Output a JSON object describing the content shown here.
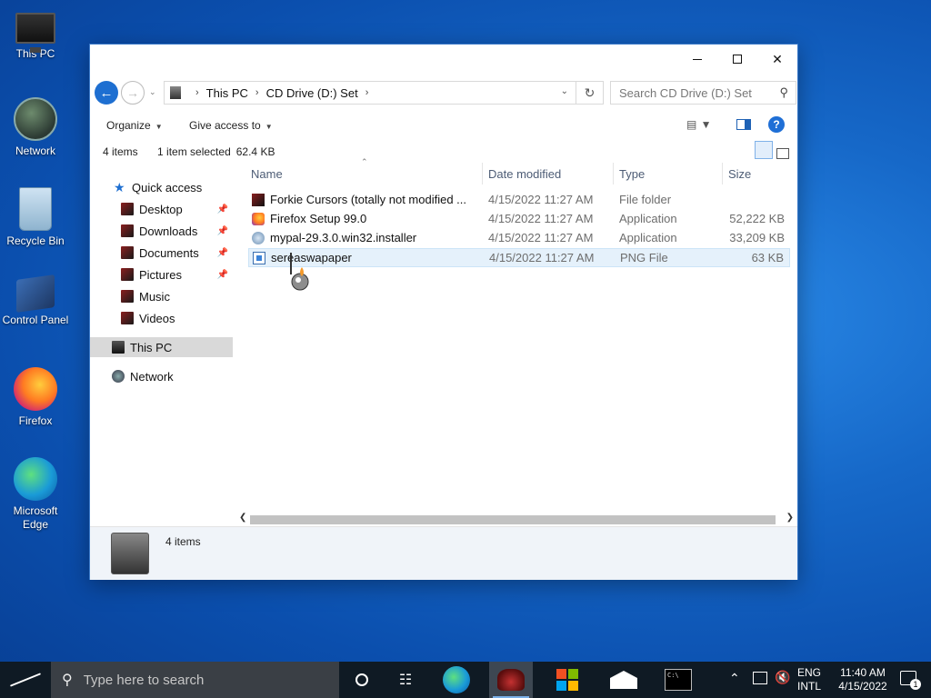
{
  "desktop": {
    "icons": [
      {
        "label": "This PC",
        "icon": "this-pc-icon"
      },
      {
        "label": "Network",
        "icon": "network-icon"
      },
      {
        "label": "Recycle Bin",
        "icon": "recycle-bin-icon"
      },
      {
        "label": "Control Panel",
        "icon": "control-panel-icon"
      },
      {
        "label": "Firefox",
        "icon": "firefox-icon"
      },
      {
        "label": "Microsoft Edge",
        "icon": "edge-icon"
      }
    ]
  },
  "window": {
    "controls": {
      "minimize": "minimize",
      "maximize": "maximize",
      "close": "✕"
    },
    "address": {
      "crumbs": [
        "This PC",
        "CD Drive (D:) Set"
      ],
      "separator": "›"
    },
    "search": {
      "placeholder": "Search CD Drive (D:) Set"
    },
    "commands": {
      "organize": "Organize",
      "give_access": "Give access to"
    },
    "status": {
      "count": "4 items",
      "selected": "1 item selected",
      "size": "62.4 KB"
    },
    "nav": {
      "quick_access": "Quick access",
      "items": [
        {
          "label": "Desktop",
          "pinned": true
        },
        {
          "label": "Downloads",
          "pinned": true
        },
        {
          "label": "Documents",
          "pinned": true
        },
        {
          "label": "Pictures",
          "pinned": true
        },
        {
          "label": "Music",
          "pinned": false
        },
        {
          "label": "Videos",
          "pinned": false
        }
      ],
      "this_pc": "This PC",
      "network": "Network"
    },
    "columns": {
      "name": "Name",
      "date": "Date modified",
      "type": "Type",
      "size": "Size"
    },
    "files": [
      {
        "name": "Forkie Cursors (totally not modified ...",
        "date": "4/15/2022 11:27 AM",
        "type": "File folder",
        "size": "",
        "icon": "folder-icon"
      },
      {
        "name": "Firefox Setup 99.0",
        "date": "4/15/2022 11:27 AM",
        "type": "Application",
        "size": "52,222 KB",
        "icon": "firefox-icon"
      },
      {
        "name": "mypal-29.3.0.win32.installer",
        "date": "4/15/2022 11:27 AM",
        "type": "Application",
        "size": "33,209 KB",
        "icon": "mypal-icon"
      },
      {
        "name": "sereaswapaper",
        "date": "4/15/2022 11:27 AM",
        "type": "PNG File",
        "size": "63 KB",
        "icon": "png-file-icon",
        "selected": true
      }
    ],
    "details_pane": {
      "text": "4 items"
    }
  },
  "taskbar": {
    "search_placeholder": "Type here to search",
    "tray": {
      "lang1": "ENG",
      "lang2": "INTL",
      "time": "11:40 AM",
      "date": "4/15/2022",
      "notifications": "1"
    }
  },
  "colors": {
    "accent": "#1e6fd1",
    "selection": "#e5f1fb",
    "taskbar": "#0f1a24"
  }
}
